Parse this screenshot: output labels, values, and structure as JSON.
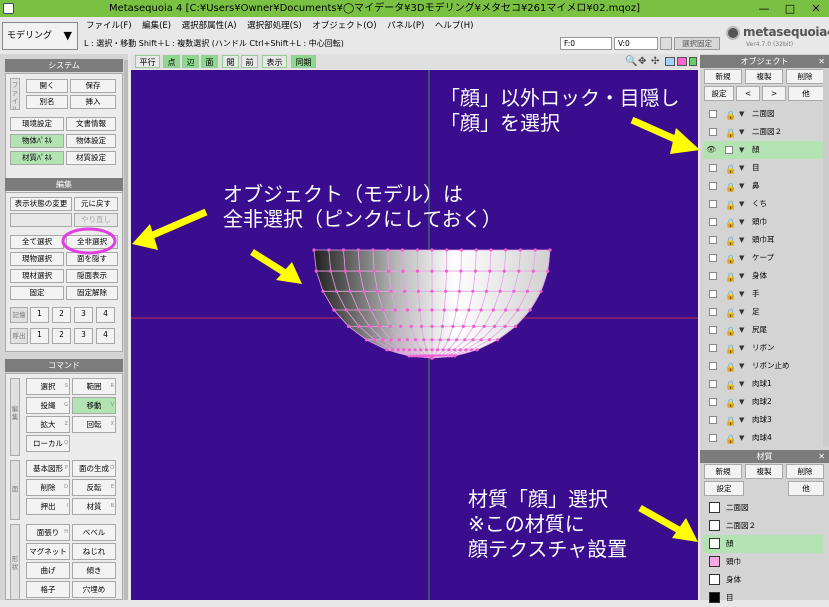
{
  "window": {
    "title": "Metasequoia 4 [C:¥Users¥Owner¥Documents¥◯マイデータ¥3Dモデリング¥メタセコ¥261マイメロ¥02.mqoz]",
    "controls": [
      "—",
      "□",
      "✕"
    ]
  },
  "mode_dropdown": {
    "value": "モデリング"
  },
  "menubar": [
    "ファイル(F)",
    "編集(E)",
    "選択部属性(A)",
    "選択部処理(S)",
    "オブジェクト(O)",
    "パネル(P)",
    "ヘルプ(H)"
  ],
  "hint": "L : 選択・移動  Shift＋L : 複数選択 (ハンドル  Ctrl+Shift＋L : 中心回転)",
  "coords": {
    "f": "F:0",
    "v": "V:0"
  },
  "lock_selection": "選択固定",
  "logo": {
    "name": "metasequoia4",
    "version": "Ver4.7.0 (32bit)"
  },
  "viewbar": {
    "buttons": [
      "平行",
      "点",
      "辺",
      "面",
      "閲",
      "前",
      "表示",
      "同期"
    ],
    "active": [
      "点",
      "辺",
      "面",
      "同期"
    ]
  },
  "system_panel": {
    "title": "システム",
    "side_label": "ファイル",
    "rows": [
      [
        "開く",
        "保存"
      ],
      [
        "別名",
        "挿入"
      ],
      [
        "環境設定",
        "文書情報"
      ],
      [
        "物体ﾊﾟﾈﾙ",
        "物体設定"
      ],
      [
        "材質ﾊﾟﾈﾙ",
        "材質設定"
      ]
    ]
  },
  "edit_panel": {
    "title": "編集",
    "rows": [
      [
        "表示状態の変更",
        "元に戻す"
      ],
      [
        "",
        "やり直し"
      ],
      [
        "全て選択",
        "全非選択"
      ],
      [
        "現物選択",
        "面を隠す"
      ],
      [
        "現材選択",
        "隠面表示"
      ],
      [
        "固定",
        "固定解除"
      ]
    ],
    "memory_label": "記憶",
    "recall_label": "呼出",
    "slots": [
      "1",
      "2",
      "3",
      "4"
    ]
  },
  "command_panel": {
    "title": "コマンド",
    "side1": "編集",
    "side2": "面",
    "side3": "形状",
    "rows": [
      [
        "選択",
        "範囲"
      ],
      [
        "投縄",
        "移動"
      ],
      [
        "拡大",
        "回転"
      ],
      [
        "ローカル",
        ""
      ],
      [
        "基本図形",
        "面の生成"
      ],
      [
        "削除",
        "反転"
      ],
      [
        "押出",
        "材質"
      ],
      [
        "面張り",
        "ベベル"
      ],
      [
        "マグネット",
        "ねじれ"
      ],
      [
        "曲げ",
        "傾き"
      ],
      [
        "格子",
        "穴埋め"
      ]
    ],
    "shortcuts": [
      [
        "S",
        "R"
      ],
      [
        "G",
        "V"
      ],
      [
        "Z",
        "X"
      ],
      [
        "Q",
        ""
      ],
      [
        "P",
        "O"
      ],
      [
        "D",
        "E"
      ],
      [
        "I",
        "B"
      ],
      [
        "H",
        ""
      ],
      [
        "",
        ""
      ],
      [
        "",
        ""
      ],
      [
        "",
        ""
      ]
    ]
  },
  "object_panel": {
    "title": "オブジェクト",
    "buttons": [
      "新規",
      "複製",
      "削除"
    ],
    "nav": [
      "設定",
      "<",
      ">",
      "他"
    ],
    "items": [
      "二面図",
      "二面図２",
      "顔",
      "目",
      "鼻",
      "くち",
      "頭巾",
      "頭巾耳",
      "ケープ",
      "身体",
      "手",
      "足",
      "尻尾",
      "リボン",
      "リボン止め",
      "肉球1",
      "肉球2",
      "肉球3",
      "肉球4"
    ],
    "selected_index": 2
  },
  "material_panel": {
    "title": "材質",
    "buttons": [
      "新規",
      "複製",
      "削除"
    ],
    "nav": [
      "設定",
      "他"
    ],
    "items": [
      {
        "name": "二面図",
        "color": "#ffffff"
      },
      {
        "name": "二面図２",
        "color": "#ffffff"
      },
      {
        "name": "顔",
        "color": "#ffffff"
      },
      {
        "name": "頭巾",
        "color": "#f7a8e0"
      },
      {
        "name": "身体",
        "color": "#ffffff"
      },
      {
        "name": "目",
        "color": "#000000"
      }
    ],
    "selected_index": 2
  },
  "annotations": {
    "a1": [
      "「顔」以外ロック・目隠し",
      "「顔」を選択"
    ],
    "a2": [
      "オブジェクト（モデル）は",
      "全非選択（ピンクにしておく）"
    ],
    "a3": [
      "材質「顔」選択",
      "※この材質に",
      "顔テクスチャ設置"
    ]
  },
  "colors": {
    "accent_green": "#7ac143",
    "viewport_bg": "#3a0c8e",
    "highlight": "#b3e3b3",
    "arrow": "#ffff00",
    "circle": "#e040e0"
  }
}
